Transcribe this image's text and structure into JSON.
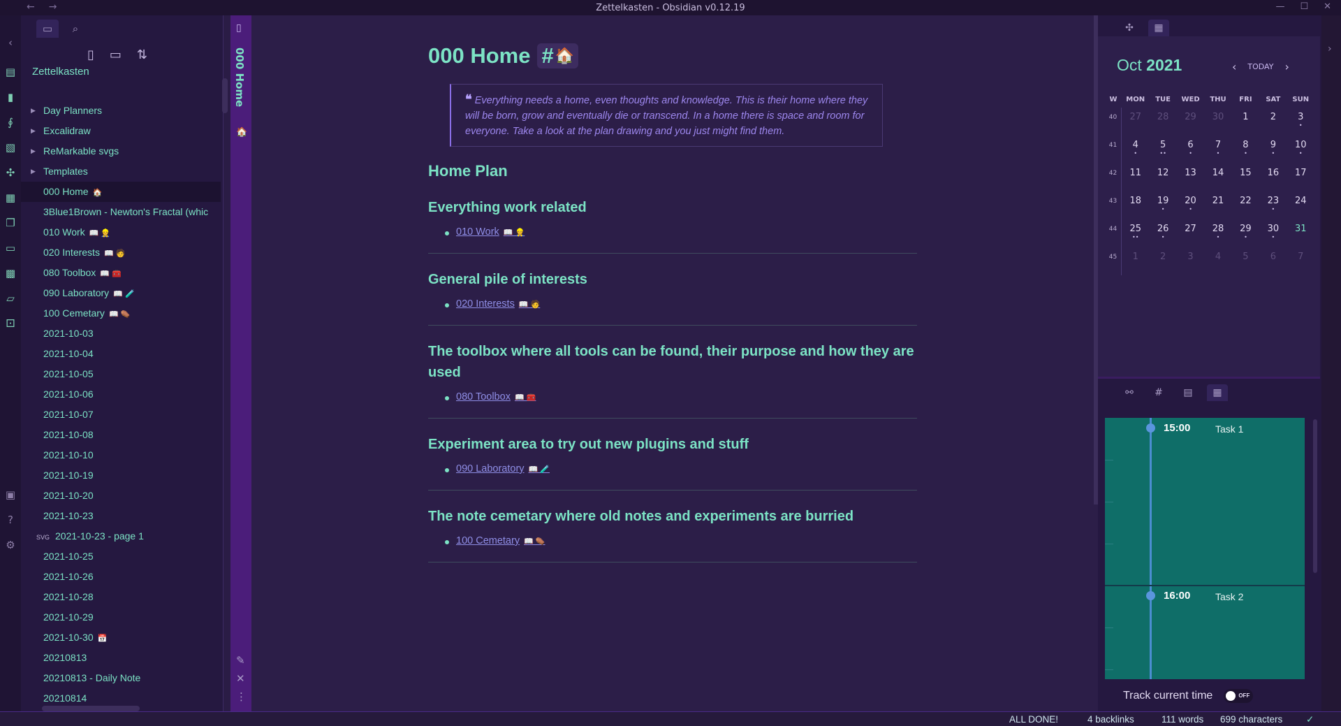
{
  "window": {
    "title": "Zettelkasten - Obsidian v0.12.19",
    "back": "←",
    "forward": "→",
    "minimize": "—",
    "maximize": "☐",
    "close": "✕"
  },
  "explorer": {
    "vault": "Zettelkasten",
    "tabs": {
      "files_icon": "folder-icon",
      "search_icon": "search-icon"
    },
    "actions": [
      "new-note-icon",
      "new-folder-icon",
      "sort-icon"
    ],
    "folders": [
      "Day Planners",
      "Excalidraw",
      "ReMarkable svgs",
      "Templates"
    ],
    "files": [
      {
        "label": "000 Home",
        "emoji": "🏠",
        "active": true
      },
      {
        "label": "3Blue1Brown - Newton's Fractal (whic",
        "emoji": ""
      },
      {
        "label": "010 Work",
        "emoji": "📖 👷"
      },
      {
        "label": "020 Interests",
        "emoji": "📖 🧑"
      },
      {
        "label": "080 Toolbox",
        "emoji": "📖 🧰"
      },
      {
        "label": "090 Laboratory",
        "emoji": "📖 🧪"
      },
      {
        "label": "100 Cemetary",
        "emoji": "📖 ⚰️"
      },
      {
        "label": "2021-10-03",
        "emoji": ""
      },
      {
        "label": "2021-10-04",
        "emoji": ""
      },
      {
        "label": "2021-10-05",
        "emoji": ""
      },
      {
        "label": "2021-10-06",
        "emoji": ""
      },
      {
        "label": "2021-10-07",
        "emoji": ""
      },
      {
        "label": "2021-10-08",
        "emoji": ""
      },
      {
        "label": "2021-10-10",
        "emoji": ""
      },
      {
        "label": "2021-10-19",
        "emoji": ""
      },
      {
        "label": "2021-10-20",
        "emoji": ""
      },
      {
        "label": "2021-10-23",
        "emoji": ""
      },
      {
        "label": "2021-10-23 - page 1",
        "emoji": "",
        "tag": "SVG"
      },
      {
        "label": "2021-10-25",
        "emoji": ""
      },
      {
        "label": "2021-10-26",
        "emoji": ""
      },
      {
        "label": "2021-10-28",
        "emoji": ""
      },
      {
        "label": "2021-10-29",
        "emoji": ""
      },
      {
        "label": "2021-10-30",
        "emoji": "📅"
      },
      {
        "label": "20210813",
        "emoji": ""
      },
      {
        "label": "20210813 - Daily Note",
        "emoji": ""
      },
      {
        "label": "20210814",
        "emoji": ""
      }
    ]
  },
  "pane": {
    "vertical_title": "000 Home",
    "emoji": "🏠"
  },
  "note": {
    "title": "000 Home",
    "title_tag": "#",
    "title_tag_emoji": "🏠",
    "quote_mark": "❝",
    "quote": "Everything needs a home, even thoughts and knowledge. This is their home where they will be born, grow and eventually die or transcend. In a home there is space and room for everyone. Take a look at the plan drawing and you just might find them.",
    "plan_heading": "Home Plan",
    "sections": [
      {
        "heading": "Everything work related",
        "link": "010 Work",
        "emoji": "📖 👷"
      },
      {
        "heading": "General pile of interests",
        "link": "020 Interests",
        "emoji": "📖 🧑"
      },
      {
        "heading": "The toolbox where all tools can be found, their purpose and how they are used",
        "link": "080 Toolbox",
        "emoji": "📖 🧰"
      },
      {
        "heading": "Experiment area to try out new plugins and stuff",
        "link": "090 Laboratory",
        "emoji": "📖 🧪"
      },
      {
        "heading": "The note cemetary where old notes and experiments are burried",
        "link": "100 Cemetary",
        "emoji": "📖 ⚰️"
      }
    ]
  },
  "calendar": {
    "month": "Oct",
    "year": "2021",
    "today_label": "TODAY",
    "prev": "‹",
    "next": "›",
    "headers": [
      "W",
      "MON",
      "TUE",
      "WED",
      "THU",
      "FRI",
      "SAT",
      "SUN"
    ],
    "weeks": [
      {
        "wk": "40",
        "days": [
          [
            "27",
            "dim",
            ""
          ],
          [
            "28",
            "dim",
            ""
          ],
          [
            "29",
            "dim",
            ""
          ],
          [
            "30",
            "dim",
            ""
          ],
          [
            "1",
            "",
            ""
          ],
          [
            "2",
            "",
            ""
          ],
          [
            "3",
            "",
            "•"
          ]
        ]
      },
      {
        "wk": "41",
        "days": [
          [
            "4",
            "",
            "•"
          ],
          [
            "5",
            "",
            "••"
          ],
          [
            "6",
            "",
            "•"
          ],
          [
            "7",
            "",
            "•"
          ],
          [
            "8",
            "",
            "•"
          ],
          [
            "9",
            "",
            "•"
          ],
          [
            "10",
            "",
            "•"
          ]
        ]
      },
      {
        "wk": "42",
        "days": [
          [
            "11",
            "",
            ""
          ],
          [
            "12",
            "",
            ""
          ],
          [
            "13",
            "",
            ""
          ],
          [
            "14",
            "",
            ""
          ],
          [
            "15",
            "",
            ""
          ],
          [
            "16",
            "",
            ""
          ],
          [
            "17",
            "",
            ""
          ]
        ]
      },
      {
        "wk": "43",
        "days": [
          [
            "18",
            "",
            ""
          ],
          [
            "19",
            "",
            "•"
          ],
          [
            "20",
            "",
            "•"
          ],
          [
            "21",
            "",
            ""
          ],
          [
            "22",
            "",
            ""
          ],
          [
            "23",
            "",
            "•"
          ],
          [
            "24",
            "",
            ""
          ]
        ]
      },
      {
        "wk": "44",
        "days": [
          [
            "25",
            "",
            "••"
          ],
          [
            "26",
            "",
            "•"
          ],
          [
            "27",
            "",
            ""
          ],
          [
            "28",
            "",
            "•"
          ],
          [
            "29",
            "",
            "•"
          ],
          [
            "30",
            "",
            "•"
          ],
          [
            "31",
            "today",
            ""
          ]
        ]
      },
      {
        "wk": "45",
        "days": [
          [
            "1",
            "dim",
            ""
          ],
          [
            "2",
            "dim",
            ""
          ],
          [
            "3",
            "dim",
            ""
          ],
          [
            "4",
            "dim",
            ""
          ],
          [
            "5",
            "dim",
            ""
          ],
          [
            "6",
            "dim",
            ""
          ],
          [
            "7",
            "dim",
            ""
          ]
        ]
      }
    ]
  },
  "planner": {
    "items": [
      {
        "time": "15:00",
        "task": "Task 1"
      },
      {
        "time": "16:00",
        "task": "Task 2"
      }
    ],
    "track_label": "Track current time",
    "toggle_label": "OFF"
  },
  "status": {
    "state": "ALL DONE!",
    "backlinks": "4 backlinks",
    "words": "111 words",
    "characters": "699 characters",
    "sync_icon": "✓"
  }
}
